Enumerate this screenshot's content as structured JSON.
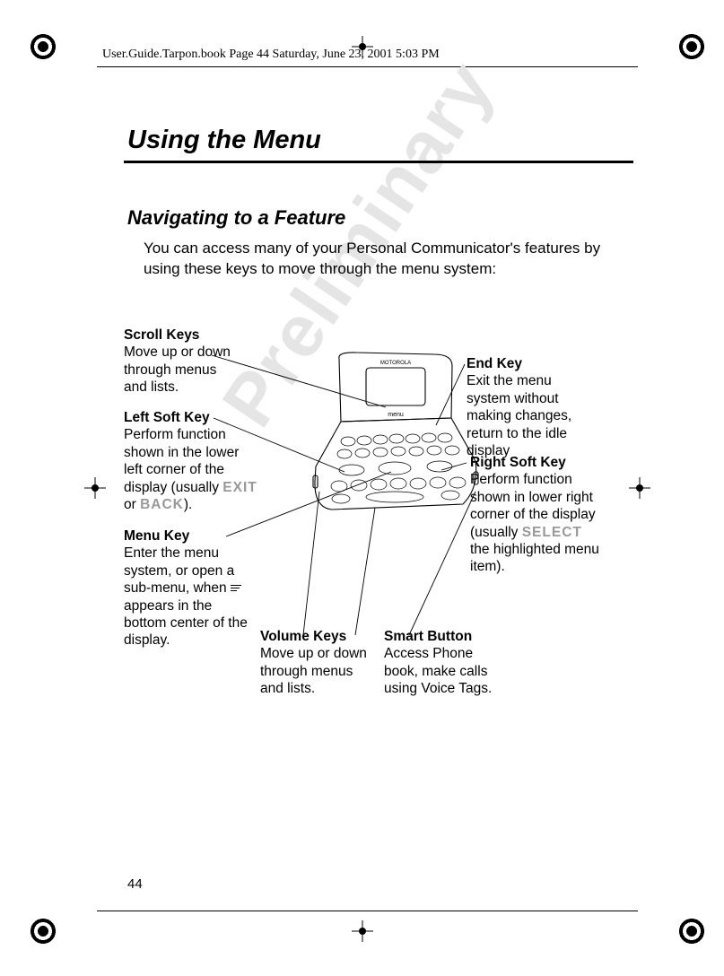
{
  "header_line": "User.Guide.Tarpon.book  Page 44  Saturday, June 23, 2001  5:03 PM",
  "heading": "Using the Menu",
  "subheading": "Navigating to a Feature",
  "intro": "You can access many of your Personal Communicator's features by using these keys to move through the menu system:",
  "callouts": {
    "scroll": {
      "title": "Scroll Keys",
      "desc": "Move up or down through menus and lists."
    },
    "left_soft": {
      "title": "Left Soft Key",
      "desc_before": "Perform function shown in the lower left corner of the display (usually ",
      "key1": "EXIT",
      "or": " or ",
      "key2": "BACK",
      "after": ")."
    },
    "menu": {
      "title": "Menu Key",
      "desc_before": "Enter the menu system, or open a sub-menu, when ",
      "desc_after": " appears in the bottom center of the display."
    },
    "volume": {
      "title": "Volume Keys",
      "desc": "Move up or down through menus and lists."
    },
    "smart": {
      "title": "Smart Button",
      "desc": "Access Phone book, make calls using Voice Tags."
    },
    "end": {
      "title": "End Key",
      "desc": "Exit the menu system without making changes, return to the idle display"
    },
    "right_soft": {
      "title": "Right Soft Key",
      "desc_before": "Perform function shown in lower right corner of the display (usually ",
      "key": "SELECT",
      "desc_after": "  the highlighted menu item)."
    }
  },
  "watermark": "Preliminary",
  "page_number": "44",
  "device_brand": "MOTOROLA",
  "device_label": "menu"
}
